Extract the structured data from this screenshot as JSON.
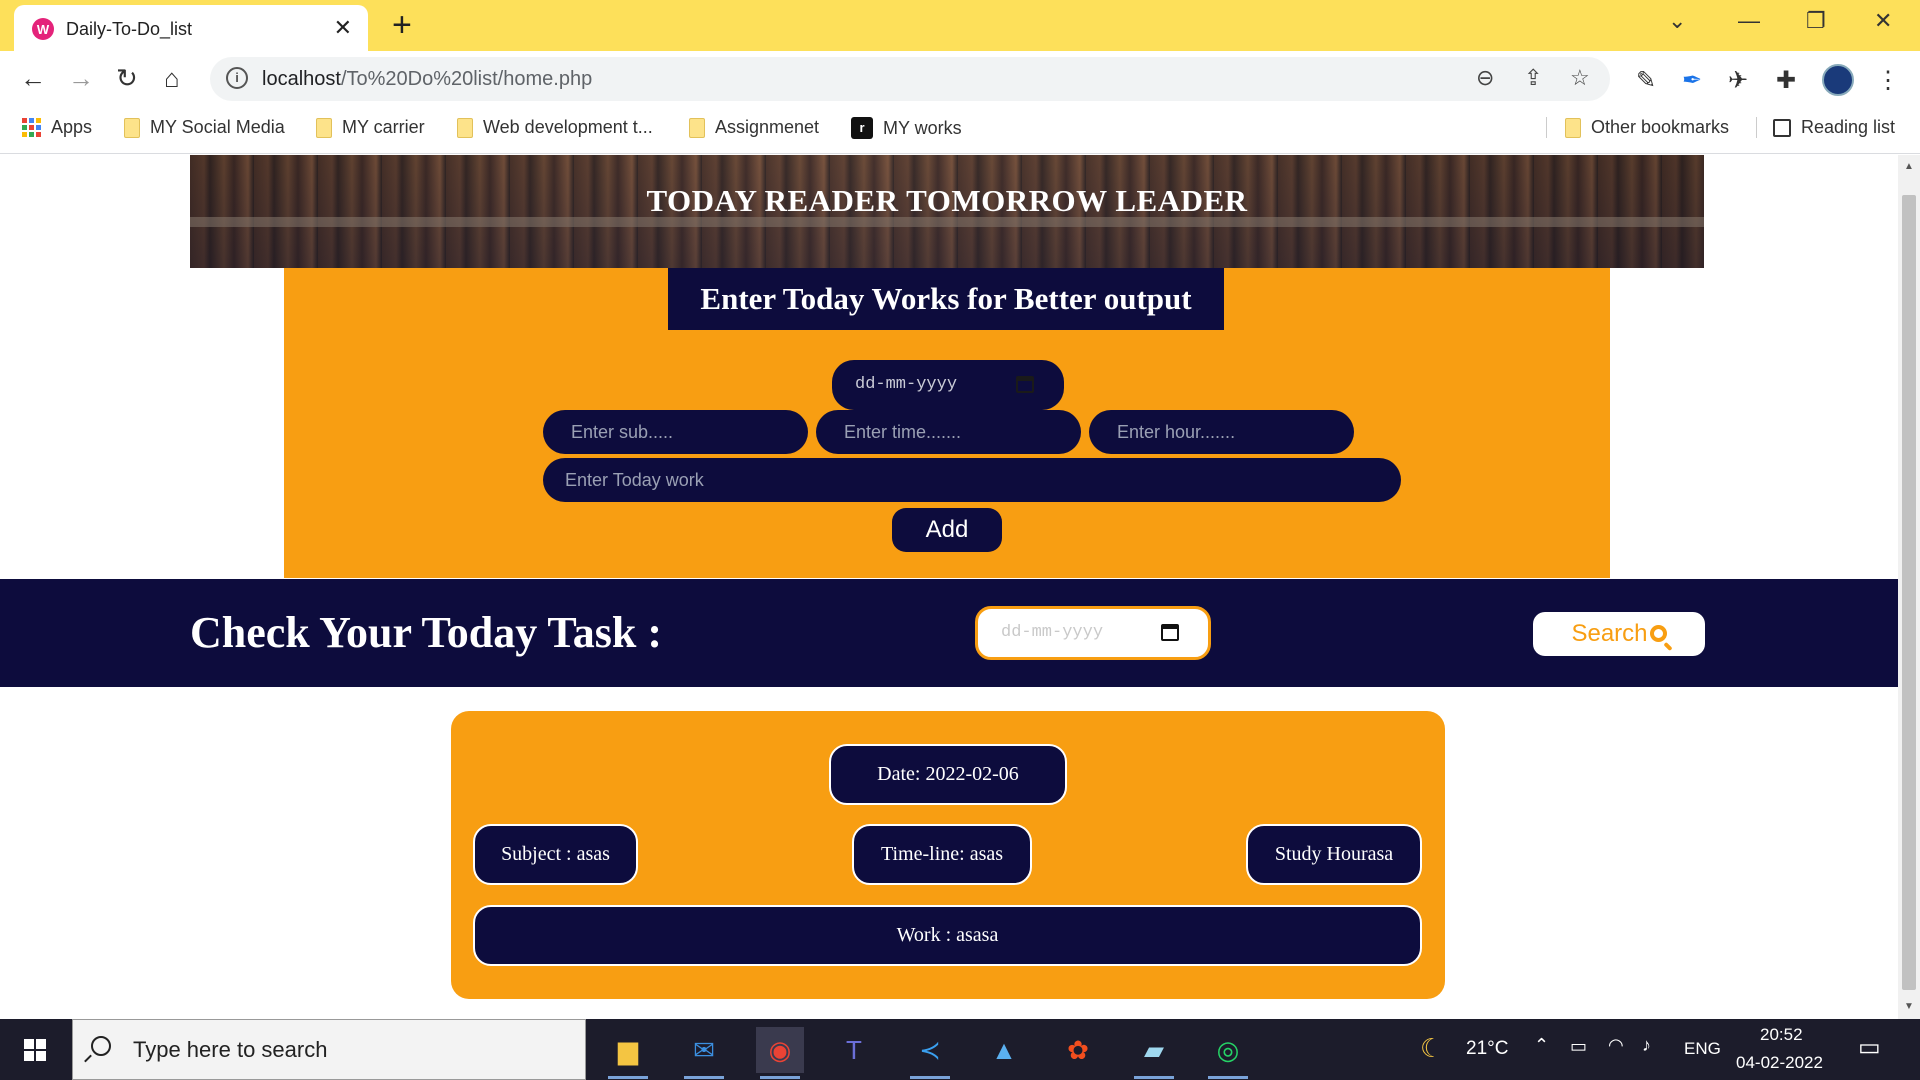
{
  "browser": {
    "tab_title": "Daily-To-Do_list",
    "tab_favicon_letter": "W",
    "url_host": "localhost",
    "url_path": "/To%20Do%20list/home.php",
    "bookmarks": [
      {
        "label": "Apps"
      },
      {
        "label": "MY Social Media"
      },
      {
        "label": "MY carrier"
      },
      {
        "label": "Web development t..."
      },
      {
        "label": "Assignmenet"
      },
      {
        "label": "MY works"
      }
    ],
    "other_bookmarks": "Other bookmarks",
    "reading_list": "Reading list"
  },
  "page": {
    "banner_title": "TODAY READER TOMORROW LEADER",
    "form": {
      "heading": "Enter Today Works for Better output",
      "date_placeholder": "dd-mm-yyyy",
      "subject_placeholder": "Enter sub.....",
      "time_placeholder": "Enter time.......",
      "hour_placeholder": "Enter hour.......",
      "work_placeholder": "Enter Today work",
      "add_label": "Add"
    },
    "check": {
      "title": "Check Your Today Task :",
      "date_placeholder": "dd-mm-yyyy",
      "search_label": "Search"
    },
    "result": {
      "date": "Date: 2022-02-06",
      "subject": "Subject : asas",
      "timeline": "Time-line: asas",
      "hours": "Study Hourasa",
      "work": "Work : asasa"
    }
  },
  "taskbar": {
    "search_placeholder": "Type here to search",
    "weather": "21°C",
    "language": "ENG",
    "time": "20:52",
    "date": "04-02-2022"
  },
  "colors": {
    "tab_strip": "#fde05a",
    "accent_orange": "#f89e12",
    "navy": "#0d0c3d"
  }
}
